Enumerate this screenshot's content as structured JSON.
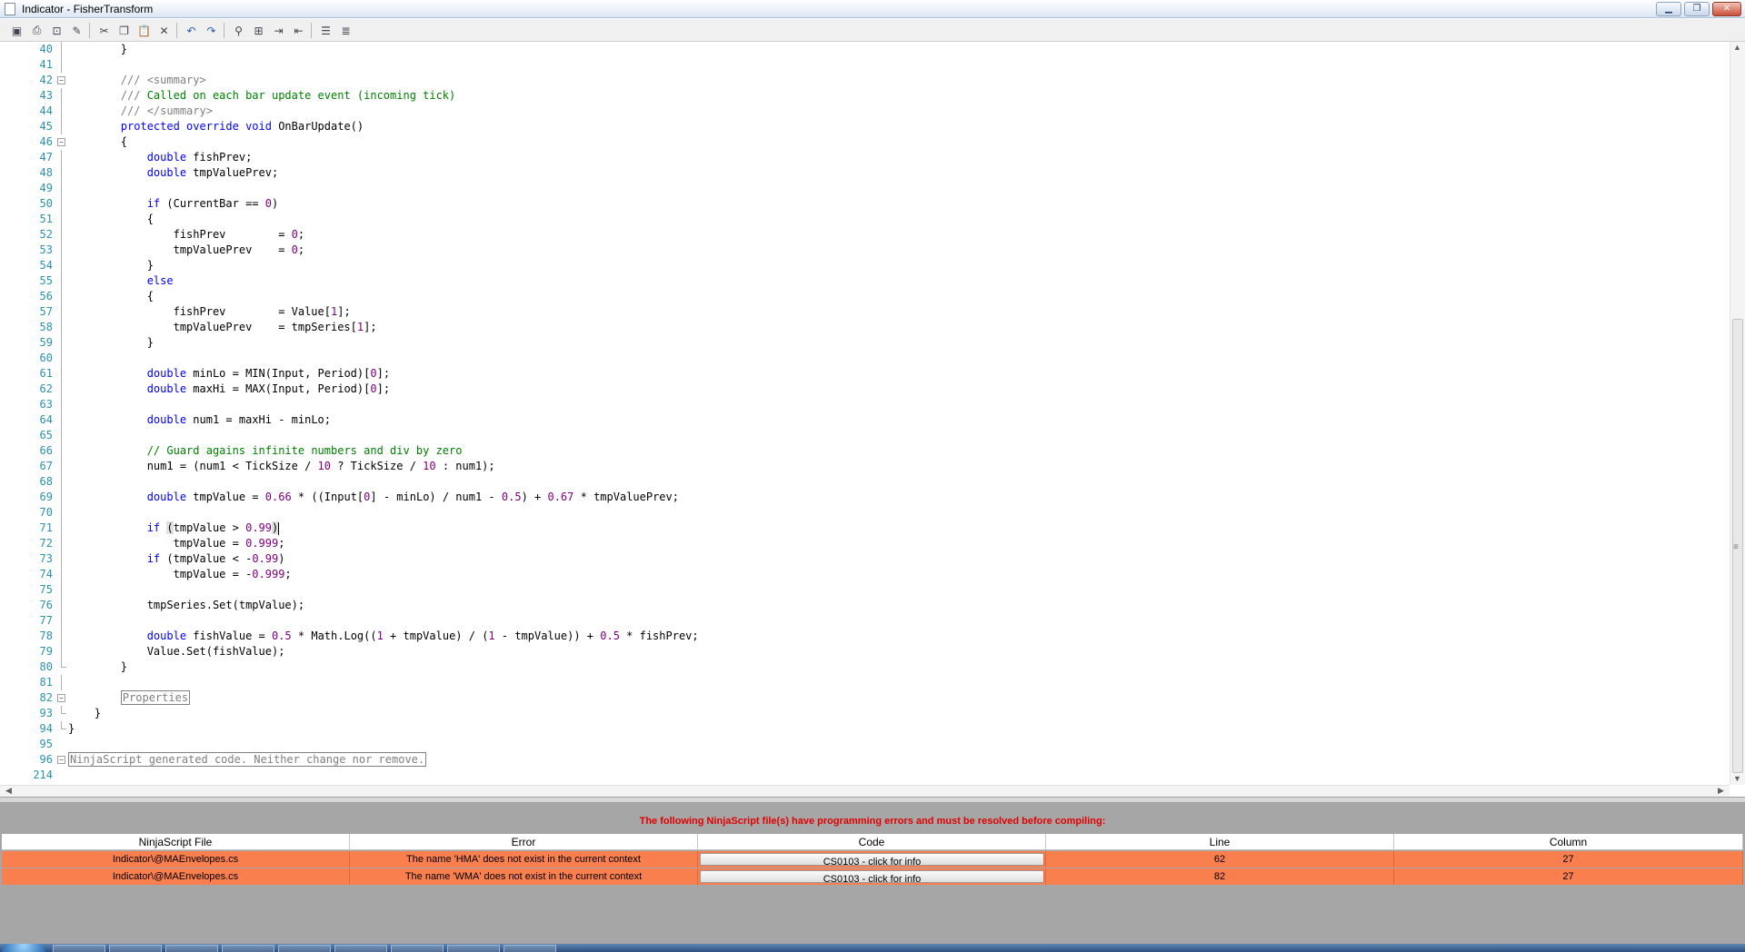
{
  "window": {
    "title": "Indicator - FisherTransform",
    "minimize_label": "▁",
    "maximize_label": "❐",
    "close_label": "✕"
  },
  "toolbar": {
    "icons": [
      "save-icon",
      "print-icon",
      "print-preview-icon",
      "compile-icon",
      "cut-icon",
      "copy-icon",
      "paste-icon",
      "delete-icon",
      "undo-icon",
      "redo-icon",
      "find-icon",
      "replace-icon",
      "indent-icon",
      "outdent-icon",
      "comment-icon",
      "uncomment-icon"
    ]
  },
  "editor": {
    "lines": [
      {
        "n": "40",
        "segs": [
          {
            "t": "        }",
            "c": ""
          }
        ],
        "fold": "line"
      },
      {
        "n": "41",
        "segs": [
          {
            "t": "",
            "c": ""
          }
        ],
        "fold": "line"
      },
      {
        "n": "42",
        "segs": [
          {
            "t": "        /// ",
            "c": "cmg"
          },
          {
            "t": "<summary>",
            "c": "cmg"
          }
        ],
        "fold": "box"
      },
      {
        "n": "43",
        "segs": [
          {
            "t": "        /// ",
            "c": "cmg"
          },
          {
            "t": "Called on each bar update event (incoming tick)",
            "c": "cm"
          }
        ],
        "fold": "line"
      },
      {
        "n": "44",
        "segs": [
          {
            "t": "        /// ",
            "c": "cmg"
          },
          {
            "t": "</summary>",
            "c": "cmg"
          }
        ],
        "fold": "line"
      },
      {
        "n": "45",
        "segs": [
          {
            "t": "        ",
            "c": ""
          },
          {
            "t": "protected override void",
            "c": "kw"
          },
          {
            "t": " OnBarUpdate()",
            "c": ""
          }
        ],
        "fold": "line"
      },
      {
        "n": "46",
        "segs": [
          {
            "t": "        {",
            "c": ""
          }
        ],
        "fold": "box"
      },
      {
        "n": "47",
        "segs": [
          {
            "t": "            ",
            "c": ""
          },
          {
            "t": "double",
            "c": "kw"
          },
          {
            "t": " fishPrev;",
            "c": ""
          }
        ],
        "fold": "line"
      },
      {
        "n": "48",
        "segs": [
          {
            "t": "            ",
            "c": ""
          },
          {
            "t": "double",
            "c": "kw"
          },
          {
            "t": " tmpValuePrev;",
            "c": ""
          }
        ],
        "fold": "line"
      },
      {
        "n": "49",
        "segs": [
          {
            "t": "",
            "c": ""
          }
        ],
        "fold": "line"
      },
      {
        "n": "50",
        "segs": [
          {
            "t": "            ",
            "c": ""
          },
          {
            "t": "if",
            "c": "kw"
          },
          {
            "t": " (CurrentBar == ",
            "c": ""
          },
          {
            "t": "0",
            "c": "num"
          },
          {
            "t": ")",
            "c": ""
          }
        ],
        "fold": "line"
      },
      {
        "n": "51",
        "segs": [
          {
            "t": "            {",
            "c": ""
          }
        ],
        "fold": "line"
      },
      {
        "n": "52",
        "segs": [
          {
            "t": "                fishPrev        = ",
            "c": ""
          },
          {
            "t": "0",
            "c": "num"
          },
          {
            "t": ";",
            "c": ""
          }
        ],
        "fold": "line"
      },
      {
        "n": "53",
        "segs": [
          {
            "t": "                tmpValuePrev    = ",
            "c": ""
          },
          {
            "t": "0",
            "c": "num"
          },
          {
            "t": ";",
            "c": ""
          }
        ],
        "fold": "line"
      },
      {
        "n": "54",
        "segs": [
          {
            "t": "            }",
            "c": ""
          }
        ],
        "fold": "line"
      },
      {
        "n": "55",
        "segs": [
          {
            "t": "            ",
            "c": ""
          },
          {
            "t": "else",
            "c": "kw"
          }
        ],
        "fold": "line"
      },
      {
        "n": "56",
        "segs": [
          {
            "t": "            {",
            "c": ""
          }
        ],
        "fold": "line"
      },
      {
        "n": "57",
        "segs": [
          {
            "t": "                fishPrev        = Value[",
            "c": ""
          },
          {
            "t": "1",
            "c": "num"
          },
          {
            "t": "];",
            "c": ""
          }
        ],
        "fold": "line"
      },
      {
        "n": "58",
        "segs": [
          {
            "t": "                tmpValuePrev    = tmpSeries[",
            "c": ""
          },
          {
            "t": "1",
            "c": "num"
          },
          {
            "t": "];",
            "c": ""
          }
        ],
        "fold": "line"
      },
      {
        "n": "59",
        "segs": [
          {
            "t": "            }",
            "c": ""
          }
        ],
        "fold": "line"
      },
      {
        "n": "60",
        "segs": [
          {
            "t": "",
            "c": ""
          }
        ],
        "fold": "line"
      },
      {
        "n": "61",
        "segs": [
          {
            "t": "            ",
            "c": ""
          },
          {
            "t": "double",
            "c": "kw"
          },
          {
            "t": " minLo = MIN(Input, Period)[",
            "c": ""
          },
          {
            "t": "0",
            "c": "num"
          },
          {
            "t": "];",
            "c": ""
          }
        ],
        "fold": "line"
      },
      {
        "n": "62",
        "segs": [
          {
            "t": "            ",
            "c": ""
          },
          {
            "t": "double",
            "c": "kw"
          },
          {
            "t": " maxHi = MAX(Input, Period)[",
            "c": ""
          },
          {
            "t": "0",
            "c": "num"
          },
          {
            "t": "];",
            "c": ""
          }
        ],
        "fold": "line"
      },
      {
        "n": "63",
        "segs": [
          {
            "t": "",
            "c": ""
          }
        ],
        "fold": "line"
      },
      {
        "n": "64",
        "segs": [
          {
            "t": "            ",
            "c": ""
          },
          {
            "t": "double",
            "c": "kw"
          },
          {
            "t": " num1 = maxHi - minLo;",
            "c": ""
          }
        ],
        "fold": "line"
      },
      {
        "n": "65",
        "segs": [
          {
            "t": "",
            "c": ""
          }
        ],
        "fold": "line"
      },
      {
        "n": "66",
        "segs": [
          {
            "t": "            ",
            "c": ""
          },
          {
            "t": "// Guard agains infinite numbers and div by zero",
            "c": "cm"
          }
        ],
        "fold": "line"
      },
      {
        "n": "67",
        "segs": [
          {
            "t": "            num1 = (num1 < TickSize / ",
            "c": ""
          },
          {
            "t": "10",
            "c": "num"
          },
          {
            "t": " ? TickSize / ",
            "c": ""
          },
          {
            "t": "10",
            "c": "num"
          },
          {
            "t": " : num1);",
            "c": ""
          }
        ],
        "fold": "line"
      },
      {
        "n": "68",
        "segs": [
          {
            "t": "",
            "c": ""
          }
        ],
        "fold": "line"
      },
      {
        "n": "69",
        "segs": [
          {
            "t": "            ",
            "c": ""
          },
          {
            "t": "double",
            "c": "kw"
          },
          {
            "t": " tmpValue = ",
            "c": ""
          },
          {
            "t": "0.66",
            "c": "num"
          },
          {
            "t": " * ((Input[",
            "c": ""
          },
          {
            "t": "0",
            "c": "num"
          },
          {
            "t": "] - minLo) / num1 - ",
            "c": ""
          },
          {
            "t": "0.5",
            "c": "num"
          },
          {
            "t": ") + ",
            "c": ""
          },
          {
            "t": "0.67",
            "c": "num"
          },
          {
            "t": " * tmpValuePrev;",
            "c": ""
          }
        ],
        "fold": "line"
      },
      {
        "n": "70",
        "segs": [
          {
            "t": "",
            "c": ""
          }
        ],
        "fold": "line"
      },
      {
        "n": "71",
        "segs": [
          {
            "t": "            ",
            "c": ""
          },
          {
            "t": "if",
            "c": "kw"
          },
          {
            "t": " ",
            "c": ""
          },
          {
            "t": "(",
            "c": "hl"
          },
          {
            "t": "tmpValue > ",
            "c": ""
          },
          {
            "t": "0.99",
            "c": "num"
          },
          {
            "t": ")",
            "c": "hl"
          },
          {
            "t": "",
            "c": "caret"
          }
        ],
        "fold": "line"
      },
      {
        "n": "72",
        "segs": [
          {
            "t": "                tmpValue = ",
            "c": ""
          },
          {
            "t": "0.999",
            "c": "num"
          },
          {
            "t": ";",
            "c": ""
          }
        ],
        "fold": "line"
      },
      {
        "n": "73",
        "segs": [
          {
            "t": "            ",
            "c": ""
          },
          {
            "t": "if",
            "c": "kw"
          },
          {
            "t": " (tmpValue < -",
            "c": ""
          },
          {
            "t": "0.99",
            "c": "num"
          },
          {
            "t": ")",
            "c": ""
          }
        ],
        "fold": "line"
      },
      {
        "n": "74",
        "segs": [
          {
            "t": "                tmpValue = -",
            "c": ""
          },
          {
            "t": "0.999",
            "c": "num"
          },
          {
            "t": ";",
            "c": ""
          }
        ],
        "fold": "line"
      },
      {
        "n": "75",
        "segs": [
          {
            "t": "",
            "c": ""
          }
        ],
        "fold": "line"
      },
      {
        "n": "76",
        "segs": [
          {
            "t": "            tmpSeries.Set(tmpValue);",
            "c": ""
          }
        ],
        "fold": "line"
      },
      {
        "n": "77",
        "segs": [
          {
            "t": "",
            "c": ""
          }
        ],
        "fold": "line"
      },
      {
        "n": "78",
        "segs": [
          {
            "t": "            ",
            "c": ""
          },
          {
            "t": "double",
            "c": "kw"
          },
          {
            "t": " fishValue = ",
            "c": ""
          },
          {
            "t": "0.5",
            "c": "num"
          },
          {
            "t": " * Math.Log((",
            "c": ""
          },
          {
            "t": "1",
            "c": "num"
          },
          {
            "t": " + tmpValue) / (",
            "c": ""
          },
          {
            "t": "1",
            "c": "num"
          },
          {
            "t": " - tmpValue)) + ",
            "c": ""
          },
          {
            "t": "0.5",
            "c": "num"
          },
          {
            "t": " * fishPrev;",
            "c": ""
          }
        ],
        "fold": "line"
      },
      {
        "n": "79",
        "segs": [
          {
            "t": "            Value.Set(fishValue);",
            "c": ""
          }
        ],
        "fold": "line"
      },
      {
        "n": "80",
        "segs": [
          {
            "t": "        }",
            "c": ""
          }
        ],
        "fold": "end"
      },
      {
        "n": "81",
        "segs": [
          {
            "t": "",
            "c": ""
          }
        ],
        "fold": "line"
      },
      {
        "n": "82",
        "segs": [
          {
            "t": "        ",
            "c": ""
          },
          {
            "t": "Properties",
            "c": "boxed"
          }
        ],
        "fold": "box"
      },
      {
        "n": "93",
        "segs": [
          {
            "t": "    }",
            "c": ""
          }
        ],
        "fold": "end"
      },
      {
        "n": "94",
        "segs": [
          {
            "t": "}",
            "c": ""
          }
        ],
        "fold": "end"
      },
      {
        "n": "95",
        "segs": [
          {
            "t": "",
            "c": ""
          }
        ],
        "fold": "none"
      },
      {
        "n": "96",
        "segs": [
          {
            "t": "NinjaScript generated code. Neither change nor remove.",
            "c": "boxed"
          }
        ],
        "fold": "box"
      },
      {
        "n": "214",
        "segs": [
          {
            "t": "",
            "c": ""
          }
        ],
        "fold": "none"
      }
    ]
  },
  "errors": {
    "message": "The following NinjaScript file(s) have programming errors and must be resolved before compiling:",
    "headers": [
      "NinjaScript File",
      "Error",
      "Code",
      "Line",
      "Column"
    ],
    "rows": [
      {
        "file": "Indicator\\@MAEnvelopes.cs",
        "error": "The name 'HMA' does not exist in the current context",
        "code": "CS0103 - click for info",
        "line": "62",
        "column": "27"
      },
      {
        "file": "Indicator\\@MAEnvelopes.cs",
        "error": "The name 'WMA' does not exist in the current context",
        "code": "CS0103 - click for info",
        "line": "82",
        "column": "27"
      }
    ],
    "row_color": "#fa7f4f"
  }
}
